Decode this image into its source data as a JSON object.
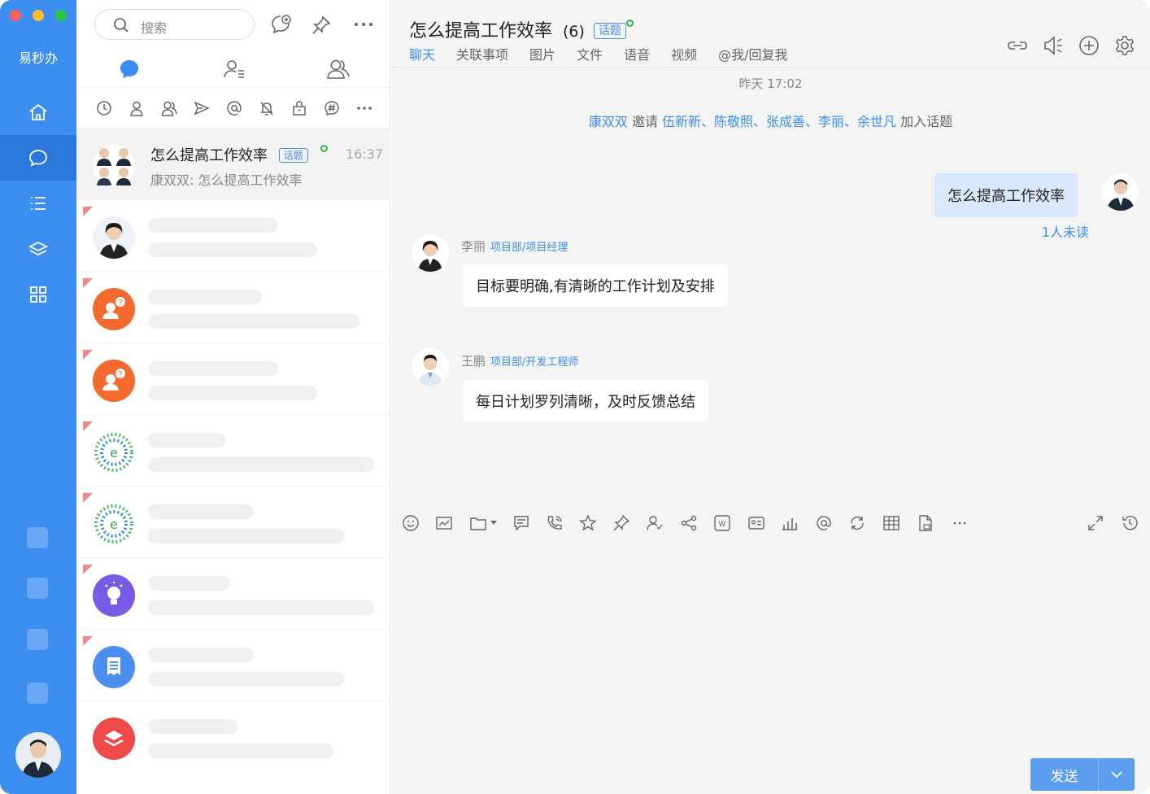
{
  "app": {
    "brand": "易秒办"
  },
  "sidebar": {
    "items": [
      "home-icon",
      "chat-icon",
      "list-icon",
      "layers-icon",
      "grid-icon"
    ],
    "active": 1
  },
  "list": {
    "search_placeholder": "搜索",
    "selected": {
      "name": "怎么提高工作效率",
      "tag": "话题",
      "time": "16:37",
      "preview": "康双双: 怎么提高工作效率"
    }
  },
  "chat": {
    "title": "怎么提高工作效率",
    "count": "(6)",
    "tag": "话题",
    "tabs": [
      "聊天",
      "关联事项",
      "图片",
      "文件",
      "语音",
      "视频",
      "@我/回复我"
    ],
    "active_tab": 0,
    "time_divider": "昨天 17:02",
    "system": {
      "inviter": "康双双",
      "verb": "邀请",
      "invitees": "伍新新、陈敬照、张成善、李丽、余世凡",
      "suffix": "加入话题"
    },
    "messages": [
      {
        "mine": true,
        "text": "怎么提高工作效率",
        "status": "1人未读"
      },
      {
        "sender": "李丽",
        "dept": "项目部/项目经理",
        "text": "目标要明确,有清晰的工作计划及安排"
      },
      {
        "sender": "王鹏",
        "dept": "项目部/开发工程师",
        "text": "每日计划罗列清晰，及时反馈总结"
      }
    ],
    "send_label": "发送"
  },
  "colors": {
    "accent": "#3d8ef1",
    "rail": "#3d8ef1",
    "bubble_mine": "#d9e8fc"
  }
}
